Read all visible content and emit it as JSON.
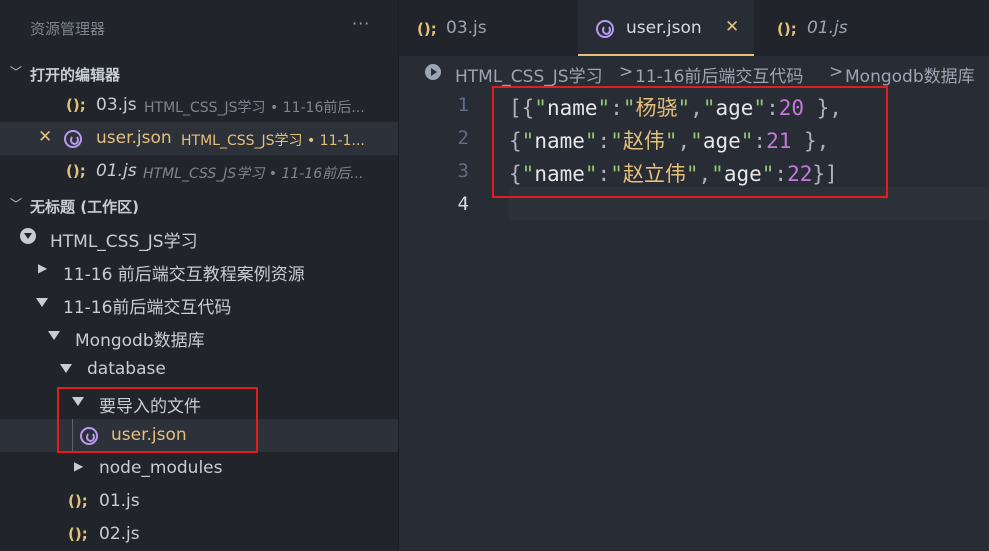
{
  "explorer": {
    "title": "资源管理器",
    "more": "···",
    "open_editors_label": "打开的编辑器",
    "open_editors": [
      {
        "name": "03.js",
        "desc": "HTML_CSS_JS学习 • 11-16前后..."
      },
      {
        "name": "user.json",
        "desc": "HTML_CSS_JS学习 • 11-1..."
      },
      {
        "name": "01.js",
        "desc": "HTML_CSS_JS学习 • 11-16前后..."
      }
    ],
    "workspace_label": "无标题 (工作区)",
    "tree": {
      "root": "HTML_CSS_JS学习",
      "folder1": "11-16 前后端交互教程案例资源",
      "folder2": "11-16前后端交互代码",
      "folder3": "Mongodb数据库",
      "folder4": "database",
      "folder5": "要导入的文件",
      "file_json": "user.json",
      "folder6": "node_modules",
      "file1": "01.js",
      "file2": "02.js"
    }
  },
  "tabs": [
    {
      "label": "03.js",
      "active": false
    },
    {
      "label": "user.json",
      "active": true
    },
    {
      "label": "01.js",
      "active": false
    }
  ],
  "breadcrumb": [
    "HTML_CSS_JS学习",
    ">",
    "11-16前后端交互代码",
    ">",
    "Mongodb数据库"
  ],
  "editor": {
    "line_numbers": [
      "1",
      "2",
      "3",
      "4"
    ],
    "lines": [
      {
        "open": "[{",
        "name": "杨骁",
        "age": "20",
        "close": " },"
      },
      {
        "open": "{",
        "name": "赵伟",
        "age": "21",
        "close": " },"
      },
      {
        "open": "{",
        "name": "赵立伟",
        "age": "22",
        "close": "}]"
      }
    ],
    "key_name": "name",
    "key_age": "age"
  },
  "colors": {
    "accent": "#e5c07b",
    "highlight_box": "#e01e1e",
    "json_icon": "#b89bf0"
  }
}
